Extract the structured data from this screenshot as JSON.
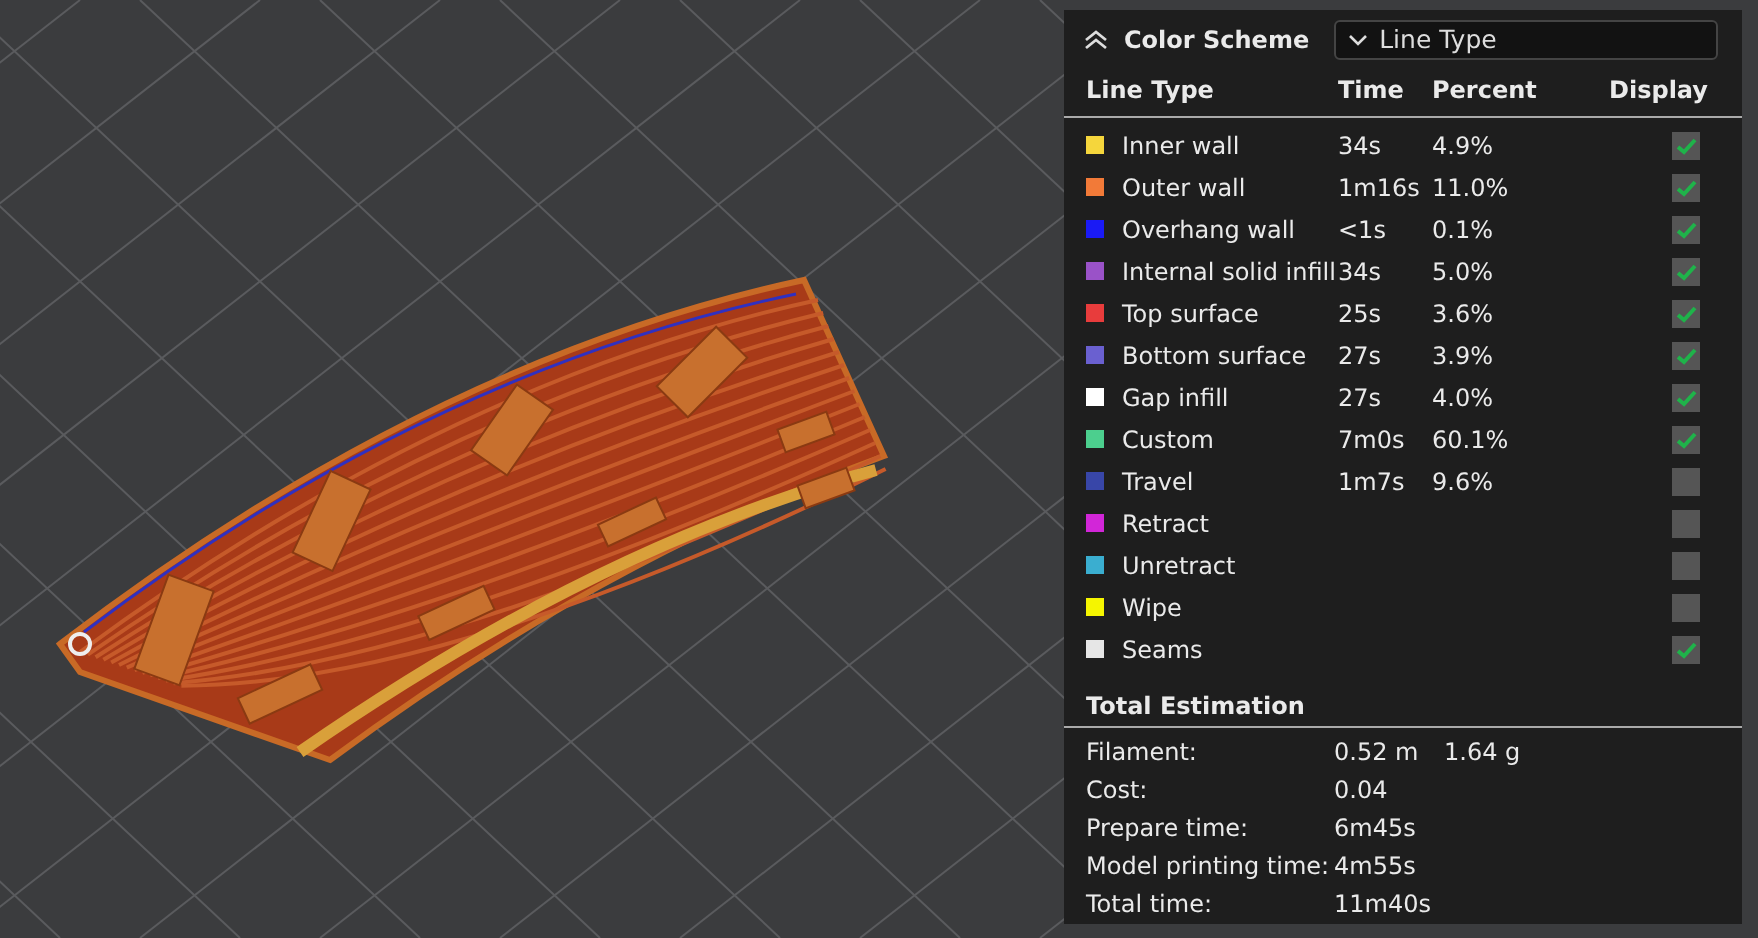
{
  "color_scheme": {
    "title": "Color Scheme",
    "dropdown_value": "Line Type"
  },
  "table": {
    "columns": [
      "Line Type",
      "Time",
      "Percent",
      "Display"
    ],
    "rows": [
      {
        "name": "Inner wall",
        "time": "34s",
        "percent": "4.9%",
        "color": "#f5d63c",
        "checked": true
      },
      {
        "name": "Outer wall",
        "time": "1m16s",
        "percent": "11.0%",
        "color": "#f27a38",
        "checked": true
      },
      {
        "name": "Overhang wall",
        "time": "<1s",
        "percent": "0.1%",
        "color": "#1a1af5",
        "checked": true
      },
      {
        "name": "Internal solid infill",
        "time": "34s",
        "percent": "5.0%",
        "color": "#9a52c8",
        "checked": true
      },
      {
        "name": "Top surface",
        "time": "25s",
        "percent": "3.6%",
        "color": "#e83c3c",
        "checked": true
      },
      {
        "name": "Bottom surface",
        "time": "27s",
        "percent": "3.9%",
        "color": "#6a60d0",
        "checked": true
      },
      {
        "name": "Gap infill",
        "time": "27s",
        "percent": "4.0%",
        "color": "#ffffff",
        "checked": true
      },
      {
        "name": "Custom",
        "time": "7m0s",
        "percent": "60.1%",
        "color": "#4ccf8e",
        "checked": true
      },
      {
        "name": "Travel",
        "time": "1m7s",
        "percent": "9.6%",
        "color": "#3846a8",
        "checked": false
      },
      {
        "name": "Retract",
        "color": "#d226d8",
        "checked": false
      },
      {
        "name": "Unretract",
        "color": "#3aaed0",
        "checked": false
      },
      {
        "name": "Wipe",
        "color": "#f5f500",
        "checked": false
      },
      {
        "name": "Seams",
        "color": "#e6e6e6",
        "checked": true
      }
    ]
  },
  "total_estimation": {
    "title": "Total Estimation",
    "rows": [
      {
        "label": "Filament:",
        "values": [
          "0.52 m",
          "1.64 g"
        ]
      },
      {
        "label": "Cost:",
        "values": [
          "0.04"
        ]
      },
      {
        "label": "Prepare time:",
        "values": [
          "6m45s"
        ]
      },
      {
        "label": "Model printing time:",
        "values": [
          "4m55s"
        ]
      },
      {
        "label": "Total time:",
        "values": [
          "11m40s"
        ]
      }
    ]
  }
}
